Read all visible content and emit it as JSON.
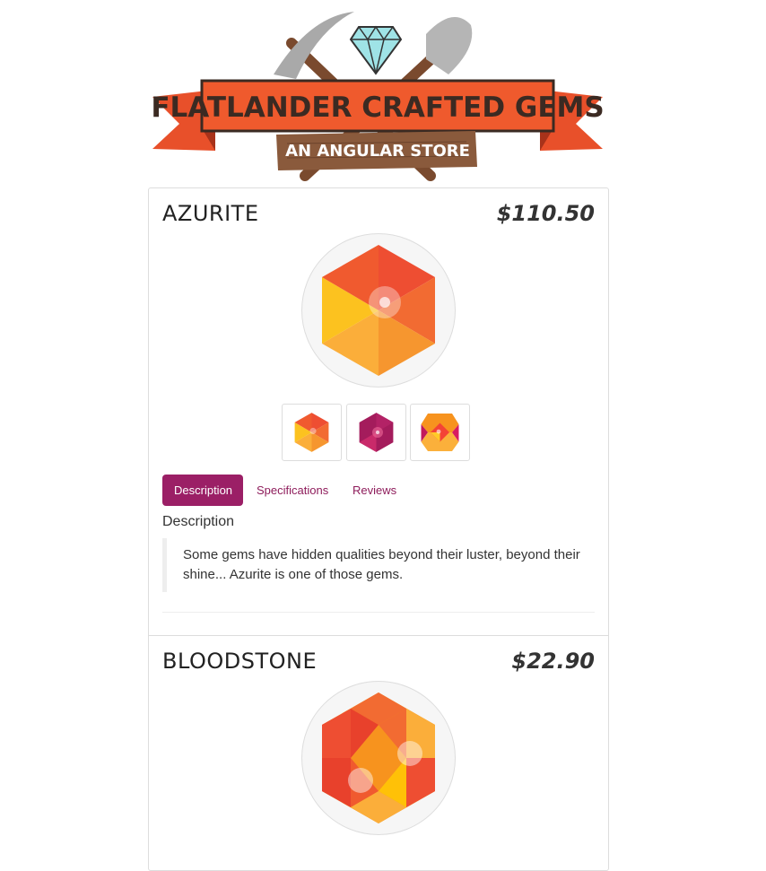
{
  "header": {
    "logo_title": "FLATLANDER CRAFTED GEMS",
    "logo_subtitle": "AN ANGULAR STORE"
  },
  "products": [
    {
      "name": "AZURITE",
      "price": "$110.50",
      "thumbnails": [
        "gem-orange-hexagon-icon",
        "gem-magenta-hexagon-icon",
        "gem-orange-star-icon"
      ],
      "tabs": [
        "Description",
        "Specifications",
        "Reviews"
      ],
      "active_tab": "Description",
      "section_title": "Description",
      "description": "Some gems have hidden qualities beyond their luster, beyond their shine... Azurite is one of those gems."
    },
    {
      "name": "BLOODSTONE",
      "price": "$22.90"
    }
  ],
  "colors": {
    "accent": "#9b1f66",
    "tab_link": "#8e1c5b",
    "banner": "#e8502a",
    "wood": "#8a5a3c"
  }
}
